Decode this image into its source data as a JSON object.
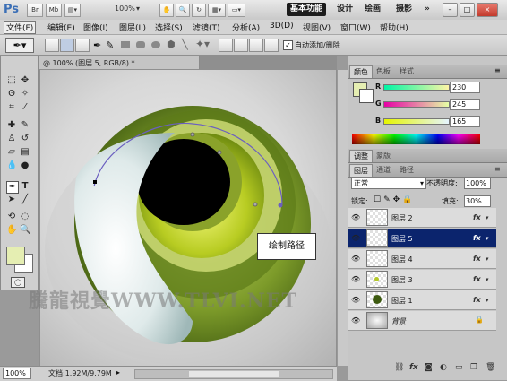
{
  "app": {
    "logo": "Ps",
    "br_label": "Br",
    "mb_label": "Mb",
    "zoom": "100%"
  },
  "workspaces": {
    "active": "基本功能",
    "items": [
      "设计",
      "绘画",
      "摄影"
    ],
    "more": "»"
  },
  "window_controls": {
    "minimize": "–",
    "restore": "□",
    "close": "×"
  },
  "menu": {
    "items": [
      "文件(F)",
      "编辑(E)",
      "图像(I)",
      "图层(L)",
      "选择(S)",
      "滤镜(T)",
      "分析(A)",
      "3D(D)",
      "视图(V)",
      "窗口(W)",
      "帮助(H)"
    ]
  },
  "options": {
    "auto_add_delete_label": "自动添加/删除",
    "auto_add_delete_checked": "✓"
  },
  "document": {
    "tab_title": "@ 100% (图层 5, RGB/8) *",
    "callout": "绘制路径",
    "watermark": "騰龍視覺WWW.TLVI.NET"
  },
  "status": {
    "zoom": "100%",
    "doc_info": "文档:1.92M/9.79M"
  },
  "colors": {
    "foreground": "#e5eeb2",
    "background": "#ffffff"
  },
  "color_panel": {
    "tabs": [
      "颜色",
      "色板",
      "样式"
    ],
    "r_label": "R",
    "g_label": "G",
    "b_label": "B",
    "r_value": "230",
    "g_value": "245",
    "b_value": "165"
  },
  "adjust_panel": {
    "tabs": [
      "调整",
      "蒙版"
    ]
  },
  "layers_panel": {
    "tabs": [
      "图层",
      "通道",
      "路径"
    ],
    "blend_mode": "正常",
    "opacity_label": "不透明度:",
    "opacity_value": "100%",
    "lock_label": "锁定:",
    "fill_label": "填充:",
    "fill_value": "30%",
    "layers": [
      {
        "name": "图层 2",
        "fx": "fx"
      },
      {
        "name": "图层 5",
        "fx": "fx"
      },
      {
        "name": "图层 4",
        "fx": "fx"
      },
      {
        "name": "图层 3",
        "fx": "fx"
      },
      {
        "name": "图层 1",
        "fx": "fx"
      },
      {
        "name": "背景",
        "fx": ""
      }
    ]
  }
}
